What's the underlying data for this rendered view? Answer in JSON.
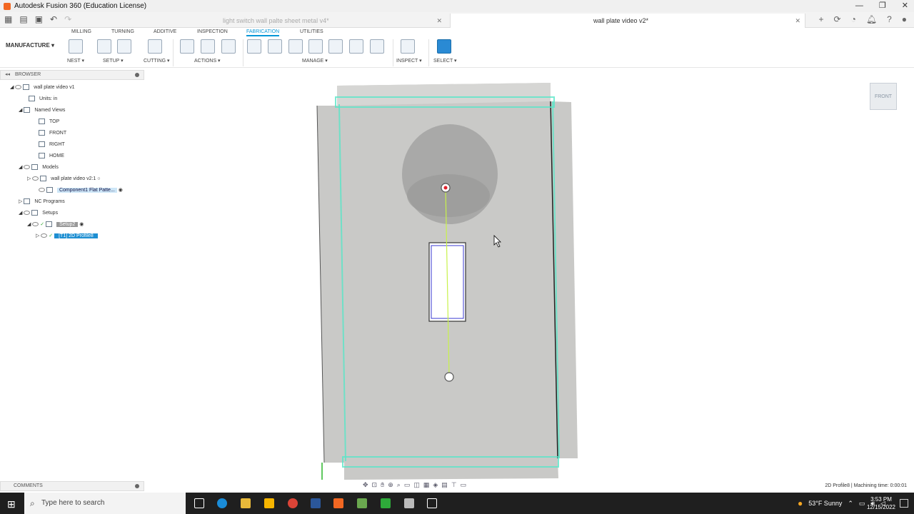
{
  "window": {
    "title": "Autodesk Fusion 360 (Education License)"
  },
  "doc_tabs": {
    "inactive": "light switch wall palte sheet metal v4*",
    "active": "wall plate video v2*"
  },
  "ribbon": {
    "workspace": "MANUFACTURE ▾",
    "tabs": [
      "MILLING",
      "TURNING",
      "ADDITIVE",
      "INSPECTION",
      "FABRICATION",
      "UTILITIES"
    ],
    "active_tab": "FABRICATION",
    "groups": [
      "NEST ▾",
      "SETUP ▾",
      "CUTTING ▾",
      "ACTIONS ▾",
      "MANAGE ▾",
      "INSPECT ▾",
      "SELECT ▾"
    ]
  },
  "browser": {
    "header": "BROWSER",
    "root": "wall plate video v1",
    "units": "Units: in",
    "named_views": "Named Views",
    "views": [
      "TOP",
      "FRONT",
      "RIGHT",
      "HOME"
    ],
    "models": "Models",
    "model_1": "wall plate video v2:1",
    "model_2": "Component1 Flat Patte...",
    "nc_programs": "NC Programs",
    "setups": "Setups",
    "setup": "Setup2",
    "operation": "[T1] 2D Profile8"
  },
  "viewcube": {
    "label": "FRONT"
  },
  "comments": {
    "label": "COMMENTS"
  },
  "status": {
    "text": "2D Profile8 | Machining time: 0:00:01"
  },
  "taskbar": {
    "search_placeholder": "Type here to search",
    "weather": "53°F  Sunny",
    "time": "3:53 PM",
    "date": "12/15/2022"
  },
  "colors": {
    "accent": "#0696d7",
    "selection": "#1e8fd2",
    "toolpath": "#59e6c8",
    "plate": "#c9c9c7"
  }
}
